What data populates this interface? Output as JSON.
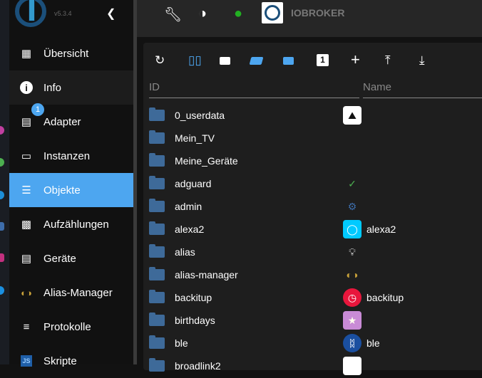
{
  "sidebar": {
    "version": "v5.3.4",
    "items": [
      {
        "label": "Übersicht",
        "icon": "grid-icon"
      },
      {
        "label": "Info",
        "icon": "info-icon"
      },
      {
        "label": "Adapter",
        "icon": "store-icon",
        "badge": "1"
      },
      {
        "label": "Instanzen",
        "icon": "instances-icon"
      },
      {
        "label": "Objekte",
        "icon": "list-icon"
      },
      {
        "label": "Aufzählungen",
        "icon": "enum-icon"
      },
      {
        "label": "Geräte",
        "icon": "devices-icon"
      },
      {
        "label": "Alias-Manager",
        "icon": "alias-icon"
      },
      {
        "label": "Protokolle",
        "icon": "log-icon"
      },
      {
        "label": "Skripte",
        "icon": "js-icon"
      }
    ]
  },
  "header": {
    "brand": "IOBROKER"
  },
  "table": {
    "col_id": "ID",
    "col_name": "Name",
    "rows": [
      {
        "id": "0_userdata",
        "name": ""
      },
      {
        "id": "Mein_TV",
        "name": ""
      },
      {
        "id": "Meine_Geräte",
        "name": ""
      },
      {
        "id": "adguard",
        "name": ""
      },
      {
        "id": "admin",
        "name": ""
      },
      {
        "id": "alexa2",
        "name": "alexa2"
      },
      {
        "id": "alias",
        "name": ""
      },
      {
        "id": "alias-manager",
        "name": ""
      },
      {
        "id": "backitup",
        "name": "backitup"
      },
      {
        "id": "birthdays",
        "name": ""
      },
      {
        "id": "ble",
        "name": "ble"
      },
      {
        "id": "broadlink2",
        "name": ""
      }
    ]
  },
  "colors": {
    "accent": "#4da6f0",
    "folder": "#3e6a99"
  }
}
